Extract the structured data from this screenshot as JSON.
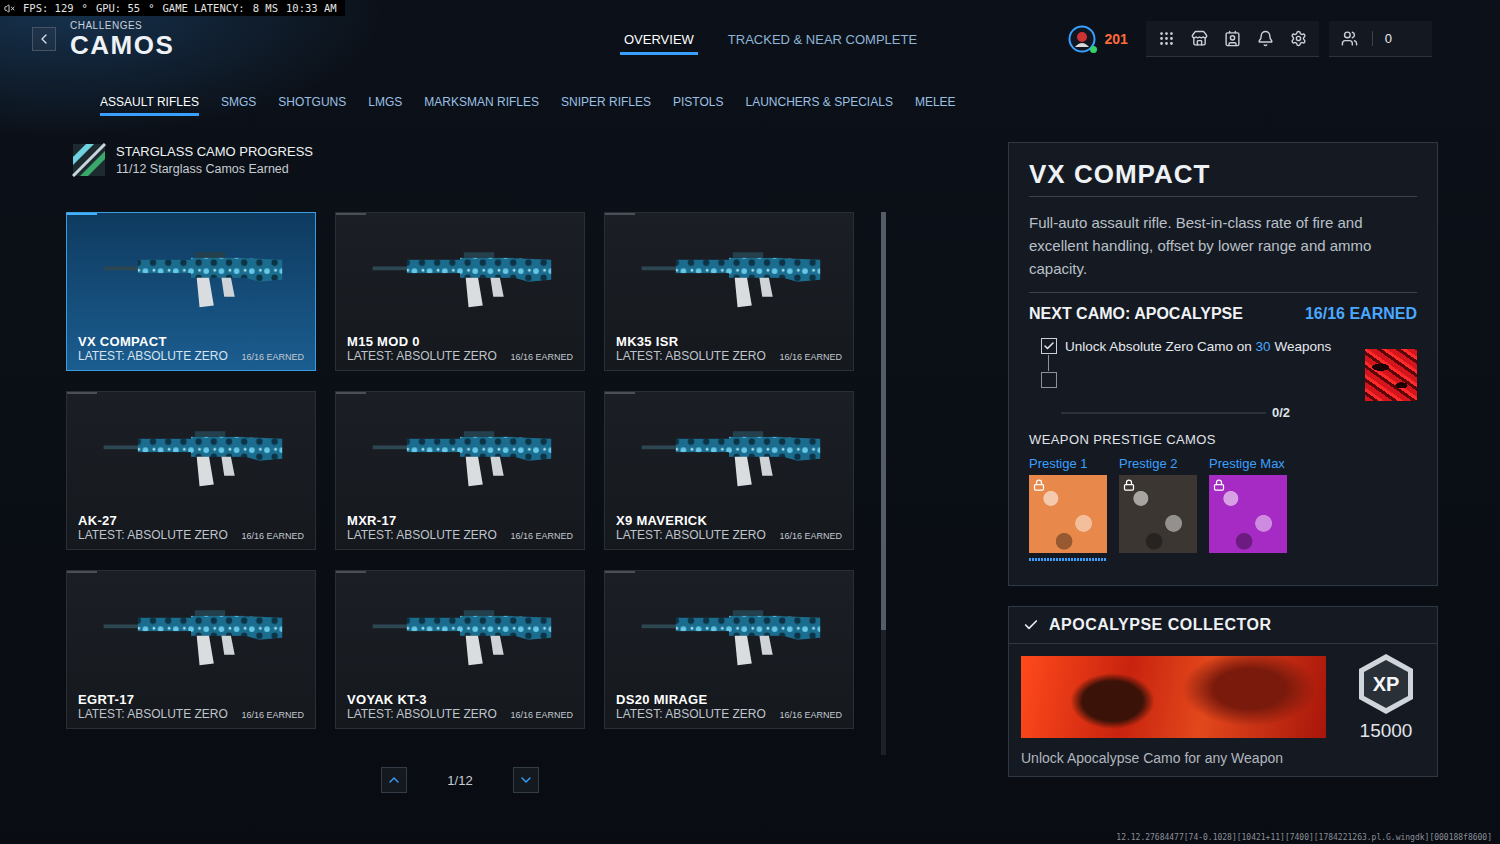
{
  "perf": {
    "sound_muted": true,
    "items": [
      "FPS: 129",
      "°",
      "GPU: 55",
      "°",
      "GAME LATENCY:",
      "8 MS",
      "10:33 AM"
    ]
  },
  "header": {
    "subtitle": "CHALLENGES",
    "title": "CAMOS"
  },
  "top_tabs": [
    {
      "label": "OVERVIEW",
      "selected": true
    },
    {
      "label": "TRACKED & NEAR COMPLETE",
      "selected": false
    }
  ],
  "player": {
    "rank": "201",
    "online": true
  },
  "friends": {
    "count": "0"
  },
  "categories": [
    {
      "label": "ASSAULT RIFLES",
      "selected": true
    },
    {
      "label": "SMGS",
      "selected": false
    },
    {
      "label": "SHOTGUNS",
      "selected": false
    },
    {
      "label": "LMGS",
      "selected": false
    },
    {
      "label": "MARKSMAN RIFLES",
      "selected": false
    },
    {
      "label": "SNIPER RIFLES",
      "selected": false
    },
    {
      "label": "PISTOLS",
      "selected": false
    },
    {
      "label": "LAUNCHERS & SPECIALS",
      "selected": false
    },
    {
      "label": "MELEE",
      "selected": false
    }
  ],
  "starglass": {
    "title": "STARGLASS CAMO PROGRESS",
    "subtitle": "11/12 Starglass Camos Earned"
  },
  "weapons": [
    {
      "name": "VX COMPACT",
      "latest": "LATEST: ABSOLUTE ZERO",
      "earned": "16/16 EARNED",
      "selected": true
    },
    {
      "name": "M15 MOD 0",
      "latest": "LATEST: ABSOLUTE ZERO",
      "earned": "16/16 EARNED",
      "selected": false
    },
    {
      "name": "MK35 ISR",
      "latest": "LATEST: ABSOLUTE ZERO",
      "earned": "16/16 EARNED",
      "selected": false
    },
    {
      "name": "AK-27",
      "latest": "LATEST: ABSOLUTE ZERO",
      "earned": "16/16 EARNED",
      "selected": false
    },
    {
      "name": "MXR-17",
      "latest": "LATEST: ABSOLUTE ZERO",
      "earned": "16/16 EARNED",
      "selected": false
    },
    {
      "name": "X9 MAVERICK",
      "latest": "LATEST: ABSOLUTE ZERO",
      "earned": "16/16 EARNED",
      "selected": false
    },
    {
      "name": "EGRT-17",
      "latest": "LATEST: ABSOLUTE ZERO",
      "earned": "16/16 EARNED",
      "selected": false
    },
    {
      "name": "VOYAK KT-3",
      "latest": "LATEST: ABSOLUTE ZERO",
      "earned": "16/16 EARNED",
      "selected": false
    },
    {
      "name": "DS20 MIRAGE",
      "latest": "LATEST: ABSOLUTE ZERO",
      "earned": "16/16 EARNED",
      "selected": false
    }
  ],
  "scrollbar": {
    "level": 0.77
  },
  "pagination": {
    "page": "1/12"
  },
  "detail": {
    "title": "VX COMPACT",
    "description": "Full-auto assault rifle. Best-in-class rate of fire and excellent handling, offset by lower range and ammo capacity.",
    "next_camo": "NEXT CAMO: APOCALYPSE",
    "next_camo_status": "16/16 EARNED",
    "challenges": [
      {
        "text": "Unlock Absolute Zero Camo on ",
        "highlight": "30",
        "text_after": " Weapons",
        "checked": true
      },
      {
        "checked": false
      }
    ],
    "progress": {
      "text": "0/2",
      "level": 0
    },
    "prestige_title": "WEAPON PRESTIGE CAMOS",
    "prestige": [
      {
        "label": "Prestige 1",
        "locked": true,
        "color": "#e8884a",
        "level": 1
      },
      {
        "label": "Prestige 2",
        "locked": true,
        "color": "#3b3631",
        "level": 0
      },
      {
        "label": "Prestige Max",
        "locked": true,
        "color": "#a62bc4",
        "level": 0
      }
    ]
  },
  "collector": {
    "title": "APOCALYPSE COLLECTOR",
    "completed": true,
    "xp_label": "XP",
    "xp": "15000",
    "description": "Unlock Apocalypse Camo for any Weapon"
  },
  "build": "12.12.27684477[74-0.1028][10421+11][7400][1784221263.pl.G.wingdk][000188f8600]"
}
